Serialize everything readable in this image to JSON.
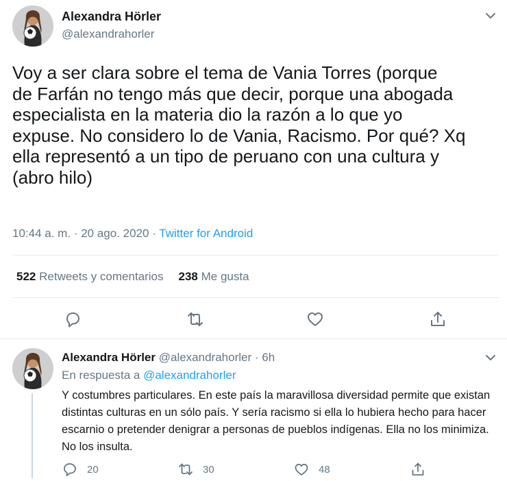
{
  "main_tweet": {
    "author_name": "Alexandra Hörler",
    "author_handle": "@alexandrahorler",
    "text": "Voy a ser clara sobre el tema de Vania Torres (porque\nde Farfán no tengo más que decir, porque una abogada\nespecialista en la materia dio la razón a lo que yo\nexpuse. No considero lo de Vania, Racismo. Por qué? Xq\nella representó a un tipo de peruano con una cultura y\n(abro hilo)",
    "time": "10:44 a. m.",
    "separator": "·",
    "date": "20 ago. 2020",
    "client": "Twitter for Android",
    "retweets_count": "522",
    "retweets_label": "Retweets y comentarios",
    "likes_count": "238",
    "likes_label": "Me gusta"
  },
  "reply_tweet": {
    "author_name": "Alexandra Hörler",
    "author_handle": "@alexandrahorler",
    "age": "· 6h",
    "in_reply_label": "En respuesta a",
    "in_reply_mention": "@alexandrahorler",
    "text": "Y costumbres particulares. En este país la maravillosa diversidad permite que existan distintas culturas en un sólo país. Y sería racismo si ella lo hubiera hecho para hacer escarnio o pretender denigrar a personas de pueblos indígenas. Ella no los minimiza. No los insulta.",
    "reply_count": "20",
    "retweet_count": "30",
    "like_count": "48"
  },
  "icons": {
    "reply": "reply-icon",
    "retweet": "retweet-icon",
    "like": "heart-icon",
    "share": "share-icon",
    "more": "chevron-down-icon"
  },
  "colors": {
    "accent": "#1da1f2",
    "secondary_text": "#657786",
    "primary_text": "#14171a",
    "border": "#e6ecf0"
  }
}
